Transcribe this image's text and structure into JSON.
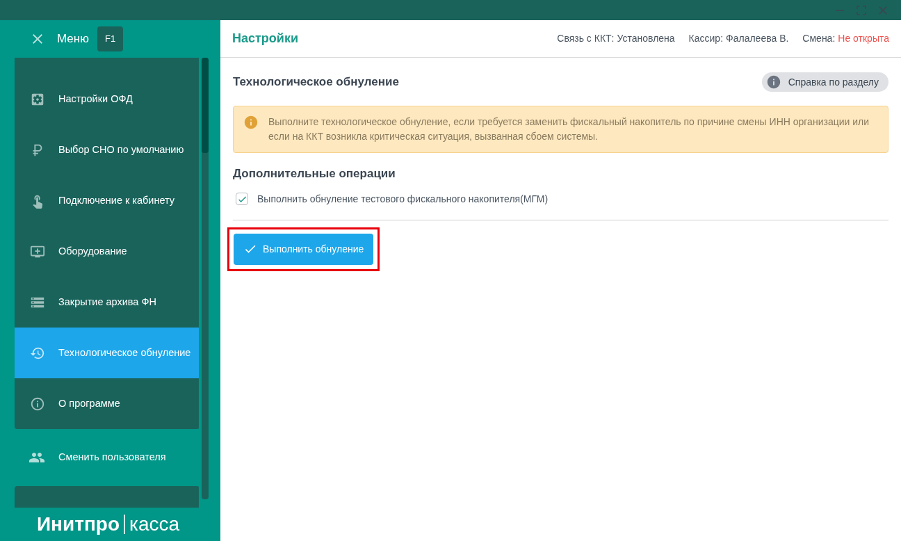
{
  "menu": {
    "title": "Меню",
    "shortcut": "F1"
  },
  "menu_items": [
    {
      "label": "Настройки ОФД",
      "selected": false
    },
    {
      "label": "Выбор СНО по умолчанию",
      "selected": false
    },
    {
      "label": "Подключение к кабинету",
      "selected": false
    },
    {
      "label": "Оборудование",
      "selected": false
    },
    {
      "label": "Закрытие архива ФН",
      "selected": false
    },
    {
      "label": "Технологическое обнуление",
      "selected": true
    },
    {
      "label": "О программе",
      "selected": false
    }
  ],
  "user_switch": {
    "label": "Сменить пользователя"
  },
  "logo": {
    "brand": "Инитпро",
    "product": "касса"
  },
  "header": {
    "title": "Настройки",
    "status": [
      {
        "label": "Связь с ККТ:",
        "value": "Установлена",
        "warning": false
      },
      {
        "label": "Кассир:",
        "value": "Фалалеева В.",
        "warning": false
      },
      {
        "label": "Смена:",
        "value": "Не открыта",
        "warning": true
      }
    ]
  },
  "section": {
    "title": "Технологическое обнуление",
    "help_button": "Справка по разделу",
    "notice": "Выполните технологическое обнуление, если требуется заменить фискальный накопитель по причине смены ИНН организации или если на ККТ возникла критическая ситуация, вызванная сбоем системы.",
    "subtitle": "Дополнительные операции",
    "option": {
      "label": "Выполнить обнуление тестового фискального накопителя(МГМ)",
      "checked": true
    },
    "action_button": {
      "label": "Выполнить обнуление",
      "highlighted": true
    }
  }
}
